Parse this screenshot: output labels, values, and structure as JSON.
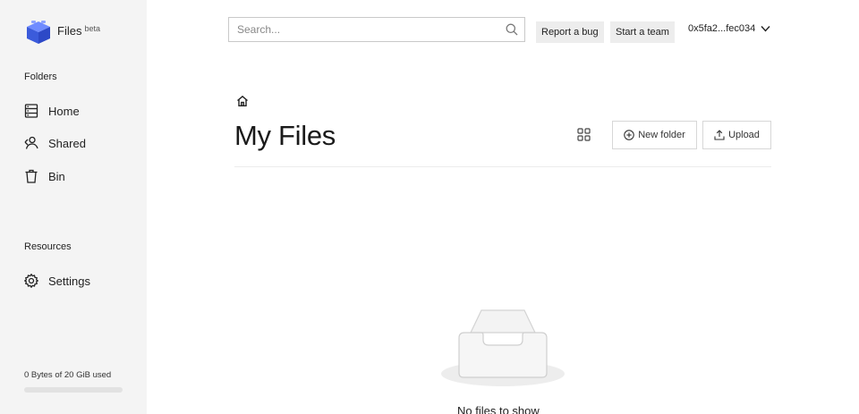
{
  "brand": {
    "name": "Files",
    "badge": "beta"
  },
  "sidebar": {
    "folders_title": "Folders",
    "items": [
      {
        "label": "Home",
        "icon": "home-drive-icon"
      },
      {
        "label": "Shared",
        "icon": "shared-users-icon"
      },
      {
        "label": "Bin",
        "icon": "trash-icon"
      }
    ],
    "resources_title": "Resources",
    "settings": {
      "label": "Settings",
      "icon": "gear-icon"
    },
    "usage": {
      "text": "0 Bytes of 20 GiB used",
      "fraction": 0
    }
  },
  "header": {
    "search_placeholder": "Search...",
    "report_bug": "Report a bug",
    "start_team": "Start a team",
    "account": "0x5fa2...fec034"
  },
  "main": {
    "title": "My Files",
    "new_folder": "New folder",
    "upload": "Upload",
    "empty_text": "No files to show"
  },
  "colors": {
    "sidebar_bg": "#f4f4f4",
    "accent": "#4b6ff0",
    "button_bg": "#ededed"
  }
}
